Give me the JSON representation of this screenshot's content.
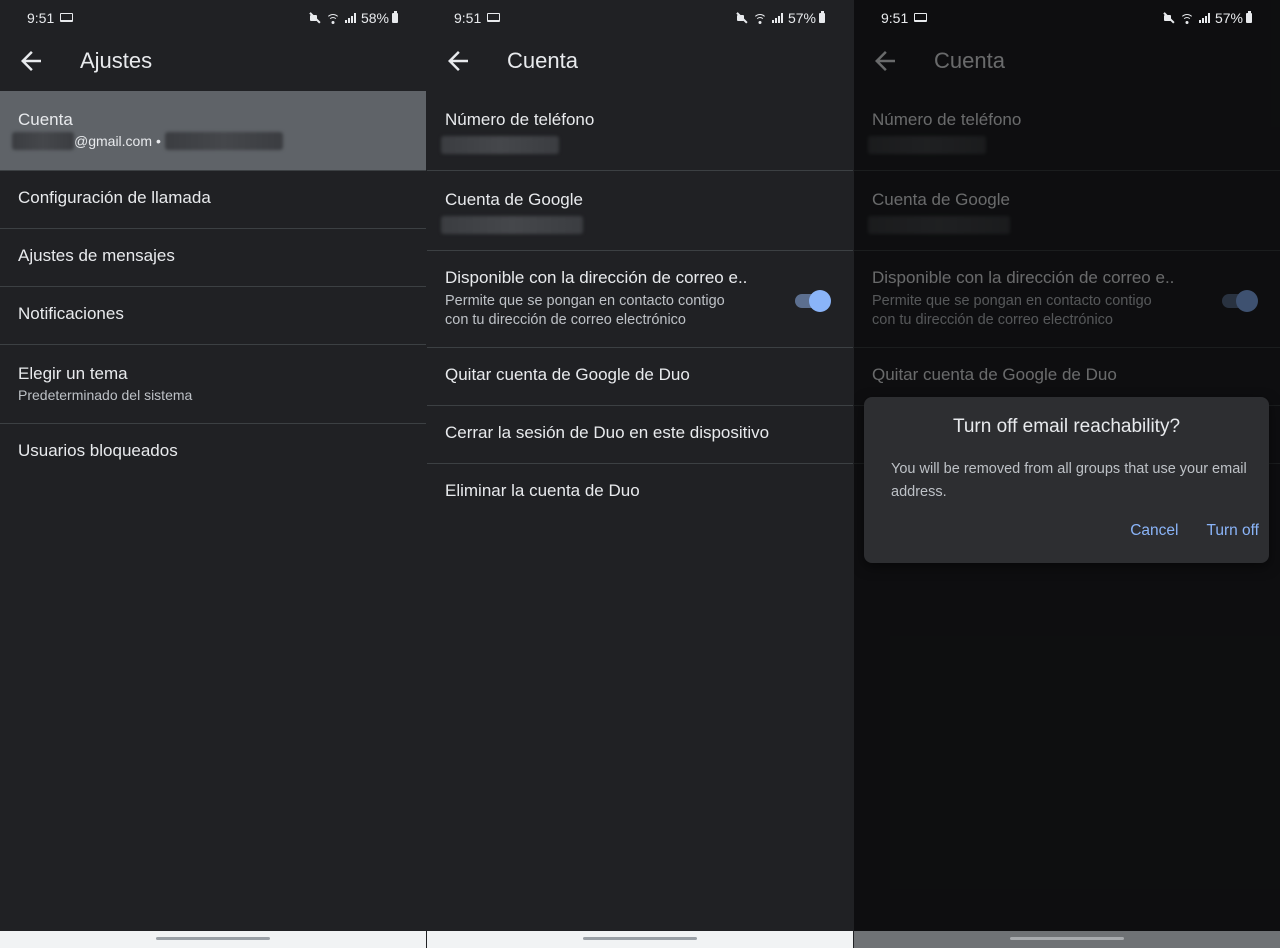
{
  "status_bar": [
    {
      "time": "9:51",
      "battery": "58%"
    },
    {
      "time": "9:51",
      "battery": "57%"
    },
    {
      "time": "9:51",
      "battery": "57%"
    }
  ],
  "settings_screen": {
    "title": "Ajustes",
    "account_title": "Cuenta",
    "account_email_suffix": "@gmail.com",
    "account_separator": "•",
    "items": [
      {
        "title": "Configuración de llamada"
      },
      {
        "title": "Ajustes de mensajes"
      },
      {
        "title": "Notificaciones"
      },
      {
        "title": "Elegir un tema",
        "subtitle": "Predeterminado del sistema"
      },
      {
        "title": "Usuarios bloqueados"
      }
    ]
  },
  "account_screen": {
    "title": "Cuenta",
    "phone_title": "Número de teléfono",
    "google_account_title": "Cuenta de Google",
    "email_reachable_title": "Disponible con la dirección de correo e..",
    "email_reachable_subtitle_1": "Permite que se pongan en contacto contigo",
    "email_reachable_subtitle_2": "con tu dirección de correo electrónico",
    "email_reachable_enabled": true,
    "remove_account": "Quitar cuenta de Google de Duo",
    "sign_out": "Cerrar la sesión de Duo en este dispositivo",
    "delete_account": "Eliminar la cuenta de Duo"
  },
  "dialog": {
    "title": "Turn off email reachability?",
    "body": "You will be removed from all groups that use your email address.",
    "cancel": "Cancel",
    "confirm": "Turn off"
  },
  "colors": {
    "background": "#202124",
    "selected_row": "#5f6368",
    "accent": "#8ab4f8",
    "divider": "#3c4043"
  }
}
